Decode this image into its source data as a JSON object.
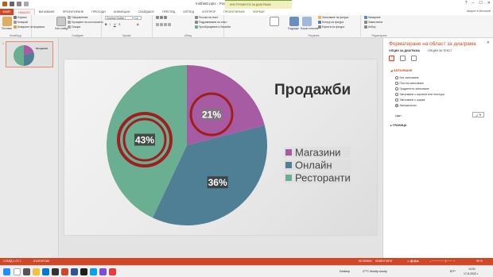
{
  "window": {
    "title": "mi0fa50.pptx - PowerPoint",
    "context_tab_group": "ИНСТРУМЕНТИ ЗА ДИАГРАМА",
    "user": "Акаунт в Microsoft"
  },
  "tabs": {
    "file": "ФАЙЛ",
    "items": [
      "НАЧАЛО",
      "ВМЪКВАНЕ",
      "ПРОЕКТИРАНЕ",
      "ПРЕХОДИ",
      "АНИМАЦИИ",
      "СЛАЙДШОУ",
      "ПРЕГЛЕД",
      "ИЗГЛЕД",
      "ХОУПРОР"
    ],
    "context": [
      "ПРОЕКТИРАНЕ",
      "ФОРМАТ"
    ]
  },
  "ribbon": {
    "paste_label": "Постави",
    "clipboard": {
      "cut": "Изрежи",
      "copy": "Копирай",
      "format_painter": "Копиране на формата",
      "label": "Клипборд"
    },
    "slides": {
      "new_slide": "Нов слайд",
      "layout": "Оформление",
      "reset": "Нулиране на състоянието",
      "section": "Секция",
      "label": "Слайдове"
    },
    "font": {
      "name": "Century Gothic (",
      "size": "12",
      "label": "Шрифт"
    },
    "paragraph": {
      "text_direction": "Посока на текст",
      "align_text": "Подравняване на текст",
      "smartart": "Преобразуване в SmartArt",
      "label": "Абзац"
    },
    "drawing": {
      "arrange": "Подреди",
      "quick_styles": "Бързи стилове",
      "fill": "Запълване на фигура",
      "outline": "Контур на фигура",
      "effects": "Ефекти на фигура",
      "label": "Рисуване"
    },
    "editing": {
      "find": "Намиране",
      "replace": "Замествене",
      "select": "Избор",
      "label": "Редактиране"
    }
  },
  "thumbnail": {
    "number": "1",
    "title": "Продажби"
  },
  "slide": {
    "title": "Продажби",
    "chart_data": {
      "type": "pie",
      "title": "Продажби",
      "categories": [
        "Магазини",
        "Онлайн",
        "Ресторанти"
      ],
      "values": [
        21,
        36,
        43
      ],
      "data_labels": [
        "21%",
        "36%",
        "43%"
      ],
      "colors": [
        "#a75ba3",
        "#4e7f95",
        "#6aaf91"
      ],
      "legend_position": "right"
    }
  },
  "pane": {
    "title": "Форматиране на област за диаграма",
    "tab_options": "ОПЦИИ ЗА ДИАГРАМА",
    "tab_text": "ОПЦИИ ЗА ТЕКСТ",
    "fill_section": "ЗАПЪЛВАНЕ",
    "fill_options": [
      "Без запълване",
      "Плътно запълване",
      "Градиентно запълване",
      "Запълване с картина или текстура",
      "Запълване с шарка",
      "Автоматично"
    ],
    "selected_fill": 5,
    "color_label": "Цвят",
    "border_section": "ГРАНИЦА"
  },
  "status": {
    "slide": "СЛАЙД 1 ОТ 1",
    "language": "БЪЛГАРСКИ",
    "notes": "БЕЛЕЖКИ",
    "comments": "КОМЕНТАРИ",
    "zoom": "95 %"
  },
  "taskbar": {
    "weather": "27°C  Mostly cloudy",
    "desktop": "Desktop",
    "lang": "БГР",
    "time": "14:51",
    "date": "17.8.2022 г."
  }
}
